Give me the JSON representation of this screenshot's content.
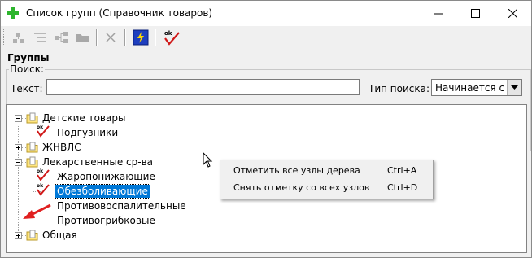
{
  "window": {
    "title": "Список групп (Справочник товаров)",
    "icons": {
      "app": "green-plus-icon",
      "minimize": "minimize-icon",
      "maximize": "maximize-icon",
      "close": "close-icon"
    }
  },
  "toolbar": {
    "buttons": [
      {
        "icon": "add-node-icon",
        "enabled": false
      },
      {
        "icon": "edit-node-icon",
        "enabled": false
      },
      {
        "icon": "hierarchy-icon",
        "enabled": false
      },
      {
        "icon": "folder-icon",
        "enabled": false
      },
      {
        "icon": "delete-x-icon",
        "enabled": false
      },
      {
        "icon": "lightning-icon",
        "enabled": true
      },
      {
        "icon": "ok-check-icon",
        "enabled": true
      }
    ]
  },
  "groups": {
    "title": "Группы",
    "search": {
      "legend": "Поиск:",
      "text_label": "Текст:",
      "text_value": "",
      "type_label": "Тип поиска:",
      "type_value": "Начинается с"
    }
  },
  "tree": {
    "nodes": [
      {
        "label": "Детские товары",
        "level": 0,
        "kind": "folder",
        "expander": "minus"
      },
      {
        "label": "Подгузники",
        "level": 1,
        "kind": "checked"
      },
      {
        "label": "ЖНВЛС",
        "level": 0,
        "kind": "folder",
        "expander": "plus"
      },
      {
        "label": "Лекарственные ср-ва",
        "level": 0,
        "kind": "folder",
        "expander": "minus"
      },
      {
        "label": "Жаропонижающие",
        "level": 1,
        "kind": "checked"
      },
      {
        "label": "Обезболивающие",
        "level": 1,
        "kind": "checked",
        "selected": true
      },
      {
        "label": "Противовоспалительные",
        "level": 1,
        "kind": "none"
      },
      {
        "label": "Противогрибковые",
        "level": 1,
        "kind": "none"
      },
      {
        "label": "Общая",
        "level": 0,
        "kind": "folder",
        "expander": "plus"
      }
    ]
  },
  "context_menu": {
    "items": [
      {
        "label": "Отметить все узлы дерева",
        "shortcut": "Ctrl+A"
      },
      {
        "label": "Снять отметку со всех узлов",
        "shortcut": "Ctrl+D"
      }
    ]
  },
  "colors": {
    "selection": "#0078d7",
    "ok_check": "#d01818",
    "annotation_arrow": "#e02020"
  }
}
